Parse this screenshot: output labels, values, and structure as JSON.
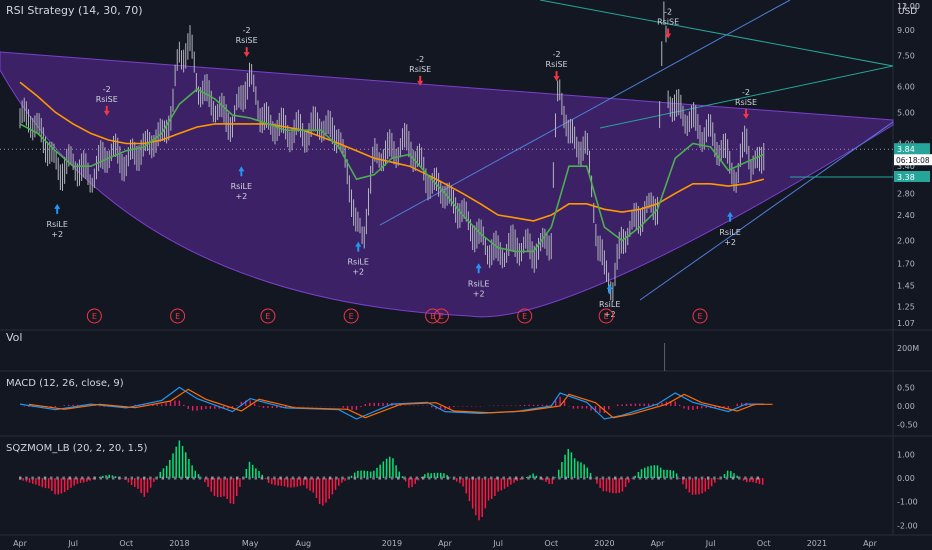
{
  "chart_data": {
    "type": "line",
    "main": {
      "title": "RSI Strategy (14, 30, 70)",
      "currency": "USD",
      "price_axis_ticks": [
        "12.00",
        "11.00",
        "9.00",
        "7.50",
        "6.00",
        "5.00",
        "4.00",
        "3.40",
        "2.80",
        "2.40",
        "2.00",
        "1.70",
        "1.45",
        "1.25",
        "1.07"
      ],
      "last_price": "3.84",
      "countdown": "06:18:08",
      "level_label": "3.38",
      "earnings_marker": "E",
      "earnings_count": 10,
      "signals": [
        {
          "type": "RsiLE",
          "label": "RsiLE",
          "qty": "+2",
          "month_index": 2.1,
          "price": 2.75
        },
        {
          "type": "RsiSE",
          "label": "RsiSE",
          "qty": "-2",
          "month_index": 4.9,
          "price": 4.6
        },
        {
          "type": "RsiSE",
          "label": "RsiSE",
          "qty": "-2",
          "month_index": 12.8,
          "price": 7.0
        },
        {
          "type": "RsiLE",
          "label": "RsiLE",
          "qty": "+2",
          "month_index": 12.5,
          "price": 3.6
        },
        {
          "type": "RsiLE",
          "label": "RsiLE",
          "qty": "+2",
          "month_index": 19.1,
          "price": 2.1
        },
        {
          "type": "RsiSE",
          "label": "RsiSE",
          "qty": "-2",
          "month_index": 22.6,
          "price": 5.7
        },
        {
          "type": "RsiLE",
          "label": "RsiLE",
          "qty": "+2",
          "month_index": 25.9,
          "price": 1.8
        },
        {
          "type": "RsiSE",
          "label": "RsiSE",
          "qty": "-2",
          "month_index": 30.3,
          "price": 5.9
        },
        {
          "type": "RsiLE",
          "label": "RsiLE",
          "qty": "+2",
          "month_index": 33.3,
          "price": 1.55
        },
        {
          "type": "RsiSE",
          "label": "RsiSE",
          "qty": "-2",
          "month_index": 36.6,
          "price": 8.0
        },
        {
          "type": "RsiSE",
          "label": "RsiSE",
          "qty": "-2",
          "month_index": 41.0,
          "price": 4.5
        },
        {
          "type": "RsiLE",
          "label": "RsiLE",
          "qty": "+2",
          "month_index": 40.1,
          "price": 2.6
        }
      ],
      "series": [
        {
          "name": "price",
          "color": "#b2b5be"
        },
        {
          "name": "ma_fast",
          "color": "#4caf50"
        },
        {
          "name": "ma_slow",
          "color": "#ff9800"
        }
      ],
      "price_points": [
        [
          0,
          4.9
        ],
        [
          1,
          4.5
        ],
        [
          1.8,
          3.6
        ],
        [
          2.3,
          3.3
        ],
        [
          3,
          3.5
        ],
        [
          4,
          3.1
        ],
        [
          5,
          3.8
        ],
        [
          6,
          3.5
        ],
        [
          7,
          3.9
        ],
        [
          8,
          4.2
        ],
        [
          8.6,
          5.0
        ],
        [
          9,
          7.6
        ],
        [
          9.6,
          8.0
        ],
        [
          10,
          6.1
        ],
        [
          11,
          5.2
        ],
        [
          12,
          4.6
        ],
        [
          13,
          6.5
        ],
        [
          13.5,
          5.0
        ],
        [
          14,
          4.6
        ],
        [
          15,
          4.4
        ],
        [
          16,
          4.3
        ],
        [
          17,
          4.6
        ],
        [
          18,
          4.2
        ],
        [
          19,
          2.2
        ],
        [
          19.4,
          2.0
        ],
        [
          20,
          3.6
        ],
        [
          21,
          3.8
        ],
        [
          22,
          4.0
        ],
        [
          22.5,
          3.5
        ],
        [
          23,
          3.1
        ],
        [
          24,
          2.8
        ],
        [
          25,
          2.4
        ],
        [
          26,
          2.0
        ],
        [
          27,
          1.8
        ],
        [
          28,
          1.95
        ],
        [
          29,
          1.85
        ],
        [
          30,
          2.0
        ],
        [
          30.4,
          6.0
        ],
        [
          31,
          4.2
        ],
        [
          32,
          3.8
        ],
        [
          32.6,
          2.0
        ],
        [
          33,
          1.6
        ],
        [
          33.5,
          1.45
        ],
        [
          34,
          2.0
        ],
        [
          35,
          2.4
        ],
        [
          36,
          2.6
        ],
        [
          36.4,
          10.5
        ],
        [
          36.6,
          5.5
        ],
        [
          37,
          5.2
        ],
        [
          38,
          4.6
        ],
        [
          39,
          4.2
        ],
        [
          40,
          3.6
        ],
        [
          40.5,
          3.0
        ],
        [
          41,
          4.4
        ],
        [
          41.3,
          3.2
        ],
        [
          42,
          3.84
        ]
      ],
      "ma_fast_points": [
        [
          0,
          4.6
        ],
        [
          1,
          4.3
        ],
        [
          2,
          3.8
        ],
        [
          3,
          3.4
        ],
        [
          4,
          3.4
        ],
        [
          5,
          3.6
        ],
        [
          6,
          3.8
        ],
        [
          7,
          3.9
        ],
        [
          8,
          4.3
        ],
        [
          9,
          5.3
        ],
        [
          10,
          5.9
        ],
        [
          11,
          5.5
        ],
        [
          12,
          4.9
        ],
        [
          13,
          4.8
        ],
        [
          14,
          4.6
        ],
        [
          15,
          4.4
        ],
        [
          16,
          4.4
        ],
        [
          17,
          4.4
        ],
        [
          18,
          3.9
        ],
        [
          19,
          3.1
        ],
        [
          20,
          3.2
        ],
        [
          21,
          3.6
        ],
        [
          22,
          3.7
        ],
        [
          23,
          3.2
        ],
        [
          24,
          2.8
        ],
        [
          25,
          2.4
        ],
        [
          26,
          2.1
        ],
        [
          27,
          1.9
        ],
        [
          28,
          1.85
        ],
        [
          29,
          1.85
        ],
        [
          30,
          2.2
        ],
        [
          31,
          3.4
        ],
        [
          32,
          3.4
        ],
        [
          33,
          2.2
        ],
        [
          34,
          2.0
        ],
        [
          35,
          2.2
        ],
        [
          36,
          2.5
        ],
        [
          37,
          3.6
        ],
        [
          38,
          4.0
        ],
        [
          39,
          3.9
        ],
        [
          40,
          3.3
        ],
        [
          41,
          3.5
        ],
        [
          42,
          3.7
        ]
      ],
      "ma_slow_points": [
        [
          0,
          6.2
        ],
        [
          1,
          5.6
        ],
        [
          2,
          5.0
        ],
        [
          3,
          4.6
        ],
        [
          4,
          4.3
        ],
        [
          5,
          4.1
        ],
        [
          6,
          4.0
        ],
        [
          7,
          4.0
        ],
        [
          8,
          4.1
        ],
        [
          9,
          4.3
        ],
        [
          10,
          4.5
        ],
        [
          11,
          4.6
        ],
        [
          12,
          4.6
        ],
        [
          13,
          4.6
        ],
        [
          14,
          4.6
        ],
        [
          15,
          4.5
        ],
        [
          16,
          4.4
        ],
        [
          17,
          4.2
        ],
        [
          18,
          4.0
        ],
        [
          19,
          3.8
        ],
        [
          20,
          3.6
        ],
        [
          21,
          3.5
        ],
        [
          22,
          3.4
        ],
        [
          23,
          3.2
        ],
        [
          24,
          3.0
        ],
        [
          25,
          2.8
        ],
        [
          26,
          2.6
        ],
        [
          27,
          2.4
        ],
        [
          28,
          2.35
        ],
        [
          29,
          2.3
        ],
        [
          30,
          2.4
        ],
        [
          31,
          2.6
        ],
        [
          32,
          2.6
        ],
        [
          33,
          2.5
        ],
        [
          34,
          2.45
        ],
        [
          35,
          2.5
        ],
        [
          36,
          2.6
        ],
        [
          37,
          2.8
        ],
        [
          38,
          3.0
        ],
        [
          39,
          3.0
        ],
        [
          40,
          2.95
        ],
        [
          41,
          3.0
        ],
        [
          42,
          3.1
        ]
      ]
    },
    "x_axis": {
      "labels": [
        "Apr",
        "Jul",
        "Oct",
        "2018",
        "May",
        "Aug",
        "2019",
        "Apr",
        "Jul",
        "Oct",
        "2020",
        "Apr",
        "Jul",
        "Oct",
        "2021",
        "Apr"
      ],
      "label_month_index": [
        0,
        3,
        6,
        9,
        13,
        16,
        21,
        24,
        27,
        30,
        33,
        36,
        39,
        42,
        45,
        48
      ]
    },
    "vol_panel": {
      "title": "Vol",
      "ticks": [
        "200M"
      ]
    },
    "macd_panel": {
      "title": "MACD (12, 26, close, 9)",
      "ticks": [
        "0.50",
        "0.00",
        "-0.50"
      ],
      "macd_color": "#2196f3",
      "signal_color": "#ff6d00",
      "hist_color": "#e91e63",
      "macd_points": [
        [
          0,
          0.05
        ],
        [
          2,
          -0.1
        ],
        [
          4,
          0.05
        ],
        [
          6,
          -0.05
        ],
        [
          8,
          0.15
        ],
        [
          9,
          0.5
        ],
        [
          10,
          0.2
        ],
        [
          12,
          -0.15
        ],
        [
          13,
          0.2
        ],
        [
          15,
          -0.05
        ],
        [
          18,
          -0.1
        ],
        [
          19,
          -0.35
        ],
        [
          21,
          0.05
        ],
        [
          23,
          0.1
        ],
        [
          24,
          -0.15
        ],
        [
          26,
          -0.2
        ],
        [
          28,
          -0.15
        ],
        [
          30,
          0.0
        ],
        [
          30.5,
          0.35
        ],
        [
          32,
          0.1
        ],
        [
          33,
          -0.35
        ],
        [
          34,
          -0.25
        ],
        [
          36,
          0.05
        ],
        [
          37,
          0.35
        ],
        [
          38,
          0.1
        ],
        [
          40,
          -0.15
        ],
        [
          41,
          0.05
        ],
        [
          42,
          0.05
        ]
      ]
    },
    "sqz_panel": {
      "title": "SQZMOM_LB (20, 2, 20, 1.5)",
      "ticks": [
        "1.00",
        "0.00",
        "-1.00",
        "-2.00"
      ],
      "pos_color": "#00e676",
      "neg_color": "#ff1744",
      "hist_points": [
        [
          0,
          -0.1
        ],
        [
          1,
          -0.3
        ],
        [
          2,
          -0.8
        ],
        [
          3,
          -0.4
        ],
        [
          4,
          -0.1
        ],
        [
          5,
          0.2
        ],
        [
          6,
          -0.1
        ],
        [
          7,
          -0.9
        ],
        [
          8,
          0.4
        ],
        [
          9,
          1.6
        ],
        [
          10,
          0.3
        ],
        [
          11,
          -0.8
        ],
        [
          12,
          -1.3
        ],
        [
          13,
          0.9
        ],
        [
          14,
          -0.2
        ],
        [
          15,
          -0.5
        ],
        [
          16,
          -0.3
        ],
        [
          17,
          -1.3
        ],
        [
          18,
          -0.4
        ],
        [
          19,
          0.3
        ],
        [
          20,
          0.4
        ],
        [
          21,
          1.0
        ],
        [
          22,
          -0.5
        ],
        [
          23,
          0.3
        ],
        [
          24,
          0.2
        ],
        [
          25,
          -0.4
        ],
        [
          26,
          -2.0
        ],
        [
          27,
          -0.6
        ],
        [
          28,
          -0.2
        ],
        [
          29,
          0.2
        ],
        [
          30,
          -0.4
        ],
        [
          31,
          1.4
        ],
        [
          32,
          0.5
        ],
        [
          33,
          -0.8
        ],
        [
          34,
          -0.6
        ],
        [
          35,
          0.4
        ],
        [
          36,
          0.6
        ],
        [
          37,
          0.3
        ],
        [
          38,
          -1.0
        ],
        [
          39,
          -0.4
        ],
        [
          40,
          0.4
        ],
        [
          41,
          -0.2
        ],
        [
          42,
          -0.3
        ]
      ]
    }
  }
}
